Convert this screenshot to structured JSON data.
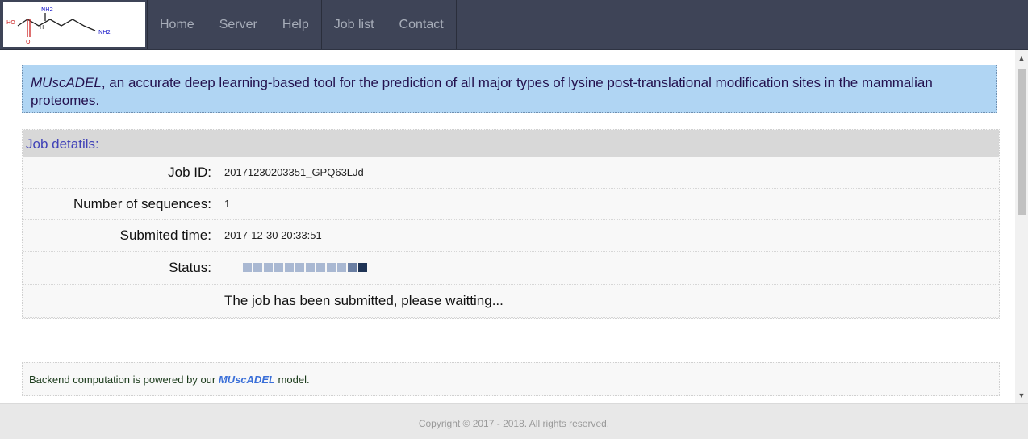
{
  "nav": {
    "items": [
      "Home",
      "Server",
      "Help",
      "Job list",
      "Contact"
    ]
  },
  "logo": {
    "labels": {
      "nh2_top": "NH2",
      "nh2_end": "NH2",
      "ho": "HO",
      "o": "O",
      "h": "H"
    }
  },
  "intro": {
    "name": "MUscADEL",
    "text": ", an accurate deep learning-based tool for the prediction of all major types of lysine post-translational modification sites in the mammalian proteomes."
  },
  "job": {
    "header": "Job detatils:",
    "id_label": "Job ID:",
    "id_value": "20171230203351_GPQ63LJd",
    "num_label": "Number of sequences:",
    "num_value": "1",
    "time_label": "Submited time:",
    "time_value": "2017-12-30 20:33:51",
    "status_label": "Status:",
    "status_squares": 12,
    "status_message": "The job has been submitted, please waitting..."
  },
  "powered": {
    "prefix": "Backend computation is powered by our ",
    "link": "MUscADEL",
    "suffix": " model."
  },
  "footer": {
    "copyright": "Copyright © 2017 - 2018. All rights reserved."
  },
  "colors": {
    "navbar": "#3e4457",
    "intro_bg": "#b0d5f3",
    "status_light": "#a9b8d2",
    "status_mid": "#6b7fa3",
    "status_dark": "#1f3355"
  }
}
